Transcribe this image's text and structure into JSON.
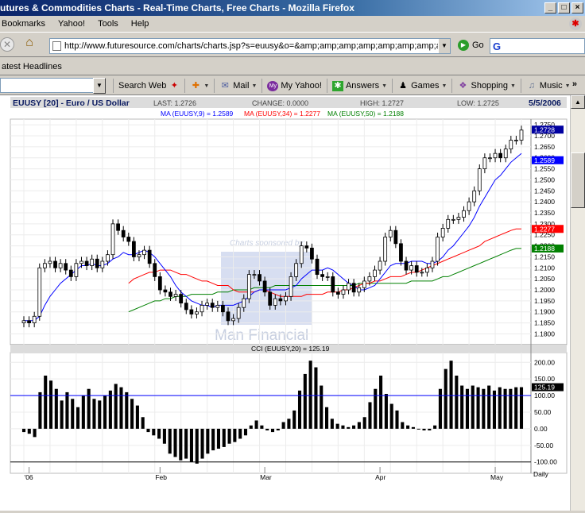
{
  "window": {
    "title": "utures & Commodities Charts - Real-Time Charts, Free Charts - Mozilla Firefox"
  },
  "menu": [
    "Bookmarks",
    "Yahoo!",
    "Tools",
    "Help"
  ],
  "nav": {
    "url": "http://www.futuresource.com/charts/charts.jsp?s=euusy&o=&amp;amp;amp;amp;amp;amp;amp;amp;amp;a=",
    "go_label": "Go",
    "search_logo": "G"
  },
  "bookmarks": {
    "item": "atest Headlines"
  },
  "yahoo_toolbar": {
    "items": [
      {
        "label": "Search Web",
        "icon": "search-web-icon"
      },
      {
        "label": "",
        "icon": "star-icon"
      },
      {
        "label": "Mail",
        "icon": "mail-icon"
      },
      {
        "label": "My Yahoo!",
        "icon": "my-yahoo-icon"
      },
      {
        "label": "Answers",
        "icon": "answers-icon"
      },
      {
        "label": "Games",
        "icon": "games-icon"
      },
      {
        "label": "Shopping",
        "icon": "shopping-icon"
      },
      {
        "label": "Music",
        "icon": "music-icon"
      }
    ],
    "more": "»"
  },
  "chart_header": {
    "symbol": "EUUSY [20] - Euro / US Dollar",
    "last": "LAST: 1.2726",
    "change": "CHANGE: 0.0000",
    "high": "HIGH: 1.2727",
    "low": "LOW: 1.2725",
    "date": "5/5/2006",
    "ma9": "MA (EUUSY,9) = 1.2589",
    "ma34": "MA (EUUSY,34) = 1.2277",
    "ma50": "MA (EUUSY,50) = 1.2188",
    "cci_label": "CCI (EUUSY,20) = 125.19",
    "sponsor": "Charts sponsored by:",
    "sponsor_name": "Man Financial",
    "period": "Daily",
    "colors": {
      "ma9": "#0000ff",
      "ma34": "#ff0000",
      "ma50": "#008000",
      "candle": "#000000",
      "cci": "#000000"
    }
  },
  "chart_data": [
    {
      "type": "candlestick",
      "title": "EUUSY [20] - Euro / US Dollar",
      "ylim": [
        1.178,
        1.2765
      ],
      "y_ticks": [
        "1.2750",
        "1.2700",
        "1.2650",
        "1.2600",
        "1.2550",
        "1.2500",
        "1.2450",
        "1.2400",
        "1.2350",
        "1.2300",
        "1.2250",
        "1.2200",
        "1.2150",
        "1.2100",
        "1.2050",
        "1.2000",
        "1.1950",
        "1.1900",
        "1.1850",
        "1.1800"
      ],
      "x_labels": [
        "'06",
        "Feb",
        "Mar",
        "Apr",
        "May"
      ],
      "value_tags": [
        {
          "value": 1.2728,
          "label": "1.2728",
          "color": "#0000a0"
        },
        {
          "value": 1.2589,
          "label": "1.2589",
          "color": "#0000ff"
        },
        {
          "value": 1.2277,
          "label": "1.2277",
          "color": "#ff0000"
        },
        {
          "value": 1.2188,
          "label": "1.2188",
          "color": "#008000"
        }
      ],
      "closes": [
        1.186,
        1.185,
        1.188,
        1.21,
        1.212,
        1.213,
        1.21,
        1.212,
        1.209,
        1.206,
        1.212,
        1.213,
        1.211,
        1.214,
        1.21,
        1.213,
        1.216,
        1.23,
        1.227,
        1.224,
        1.222,
        1.215,
        1.216,
        1.218,
        1.212,
        1.206,
        1.2,
        1.199,
        1.197,
        1.198,
        1.194,
        1.191,
        1.189,
        1.19,
        1.193,
        1.194,
        1.192,
        1.193,
        1.19,
        1.186,
        1.187,
        1.192,
        1.196,
        1.207,
        1.207,
        1.204,
        1.199,
        1.193,
        1.196,
        1.195,
        1.197,
        1.206,
        1.212,
        1.22,
        1.219,
        1.214,
        1.207,
        1.206,
        1.206,
        1.199,
        1.198,
        1.2,
        1.203,
        1.199,
        1.201,
        1.204,
        1.206,
        1.209,
        1.213,
        1.224,
        1.227,
        1.221,
        1.213,
        1.209,
        1.211,
        1.208,
        1.208,
        1.21,
        1.213,
        1.224,
        1.228,
        1.232,
        1.232,
        1.233,
        1.236,
        1.24,
        1.245,
        1.255,
        1.26,
        1.26,
        1.262,
        1.26,
        1.264,
        1.268,
        1.268,
        1.2726
      ],
      "ma9": [
        1.186,
        1.186,
        1.186,
        1.188,
        1.193,
        1.197,
        1.2,
        1.203,
        1.205,
        1.207,
        1.209,
        1.211,
        1.211,
        1.212,
        1.211,
        1.211,
        1.212,
        1.214,
        1.215,
        1.217,
        1.216,
        1.216,
        1.217,
        1.218,
        1.217,
        1.215,
        1.212,
        1.209,
        1.206,
        1.202,
        1.199,
        1.197,
        1.195,
        1.194,
        1.193,
        1.193,
        1.192,
        1.193,
        1.193,
        1.193,
        1.193,
        1.194,
        1.195,
        1.197,
        1.199,
        1.2,
        1.2,
        1.2,
        1.2,
        1.2,
        1.2,
        1.201,
        1.202,
        1.205,
        1.207,
        1.209,
        1.209,
        1.209,
        1.21,
        1.209,
        1.207,
        1.205,
        1.203,
        1.202,
        1.2,
        1.2,
        1.201,
        1.202,
        1.205,
        1.208,
        1.211,
        1.212,
        1.212,
        1.212,
        1.213,
        1.213,
        1.213,
        1.212,
        1.212,
        1.213,
        1.215,
        1.218,
        1.22,
        1.223,
        1.226,
        1.229,
        1.233,
        1.238,
        1.242,
        1.246,
        1.25,
        1.252,
        1.255,
        1.258,
        1.26,
        1.262
      ],
      "ma34": [
        null,
        null,
        null,
        null,
        null,
        null,
        null,
        null,
        null,
        null,
        null,
        null,
        null,
        null,
        null,
        null,
        null,
        null,
        null,
        null,
        1.203,
        1.205,
        1.206,
        1.207,
        1.208,
        1.208,
        1.209,
        1.209,
        1.209,
        1.208,
        1.207,
        1.207,
        1.206,
        1.205,
        1.204,
        1.204,
        1.203,
        1.202,
        1.202,
        1.202,
        1.2,
        1.199,
        1.199,
        1.199,
        1.199,
        1.2,
        1.2,
        1.199,
        1.198,
        1.197,
        1.197,
        1.197,
        1.197,
        1.197,
        1.198,
        1.198,
        1.198,
        1.198,
        1.199,
        1.199,
        1.199,
        1.2,
        1.2,
        1.201,
        1.202,
        1.203,
        1.203,
        1.204,
        1.204,
        1.205,
        1.206,
        1.206,
        1.206,
        1.207,
        1.208,
        1.208,
        1.209,
        1.21,
        1.211,
        1.212,
        1.213,
        1.214,
        1.215,
        1.216,
        1.217,
        1.218,
        1.219,
        1.22,
        1.222,
        1.223,
        1.224,
        1.225,
        1.226,
        1.227,
        1.2277,
        1.2277
      ],
      "ma50": [
        null,
        null,
        null,
        null,
        null,
        null,
        null,
        null,
        null,
        null,
        null,
        null,
        null,
        null,
        null,
        null,
        null,
        null,
        null,
        null,
        1.19,
        1.191,
        1.192,
        1.193,
        1.194,
        1.195,
        1.195,
        1.196,
        1.196,
        1.197,
        1.197,
        1.197,
        1.198,
        1.198,
        1.198,
        1.198,
        1.198,
        1.199,
        1.199,
        1.199,
        1.2,
        1.2,
        1.2,
        1.2,
        1.201,
        1.201,
        1.201,
        1.201,
        1.202,
        1.202,
        1.202,
        1.202,
        1.202,
        1.202,
        1.202,
        1.202,
        1.202,
        1.202,
        1.202,
        1.202,
        1.202,
        1.202,
        1.202,
        1.202,
        1.203,
        1.203,
        1.203,
        1.203,
        1.203,
        1.203,
        1.203,
        1.203,
        1.203,
        1.203,
        1.204,
        1.204,
        1.204,
        1.204,
        1.204,
        1.205,
        1.206,
        1.206,
        1.207,
        1.208,
        1.209,
        1.21,
        1.211,
        1.212,
        1.213,
        1.214,
        1.215,
        1.216,
        1.217,
        1.218,
        1.2188,
        1.2188
      ]
    },
    {
      "type": "bar",
      "title": "CCI (EUUSY,20) = 125.19",
      "ylim": [
        -115,
        215
      ],
      "y_ticks": [
        "200.00",
        "150.00",
        "100.00",
        "50.00",
        "0.00",
        "-50.00",
        "-100.00"
      ],
      "reference_lines": [
        100,
        -100
      ],
      "value_tag": {
        "value": 125.19,
        "label": "125.19"
      },
      "values": [
        -10,
        -15,
        -25,
        110,
        160,
        145,
        120,
        85,
        110,
        90,
        65,
        100,
        120,
        90,
        85,
        100,
        115,
        135,
        125,
        110,
        90,
        70,
        35,
        -10,
        -20,
        -30,
        -45,
        -75,
        -85,
        -95,
        -90,
        -100,
        -105,
        -90,
        -75,
        -65,
        -60,
        -55,
        -45,
        -40,
        -30,
        -20,
        10,
        25,
        10,
        -5,
        -10,
        -5,
        20,
        30,
        55,
        115,
        165,
        205,
        185,
        130,
        65,
        30,
        15,
        10,
        5,
        10,
        20,
        35,
        80,
        120,
        160,
        105,
        75,
        55,
        20,
        10,
        5,
        0,
        -5,
        -5,
        10,
        120,
        180,
        205,
        160,
        130,
        120,
        130,
        125,
        120,
        130,
        115,
        125,
        120,
        120,
        125,
        125.19
      ]
    }
  ]
}
